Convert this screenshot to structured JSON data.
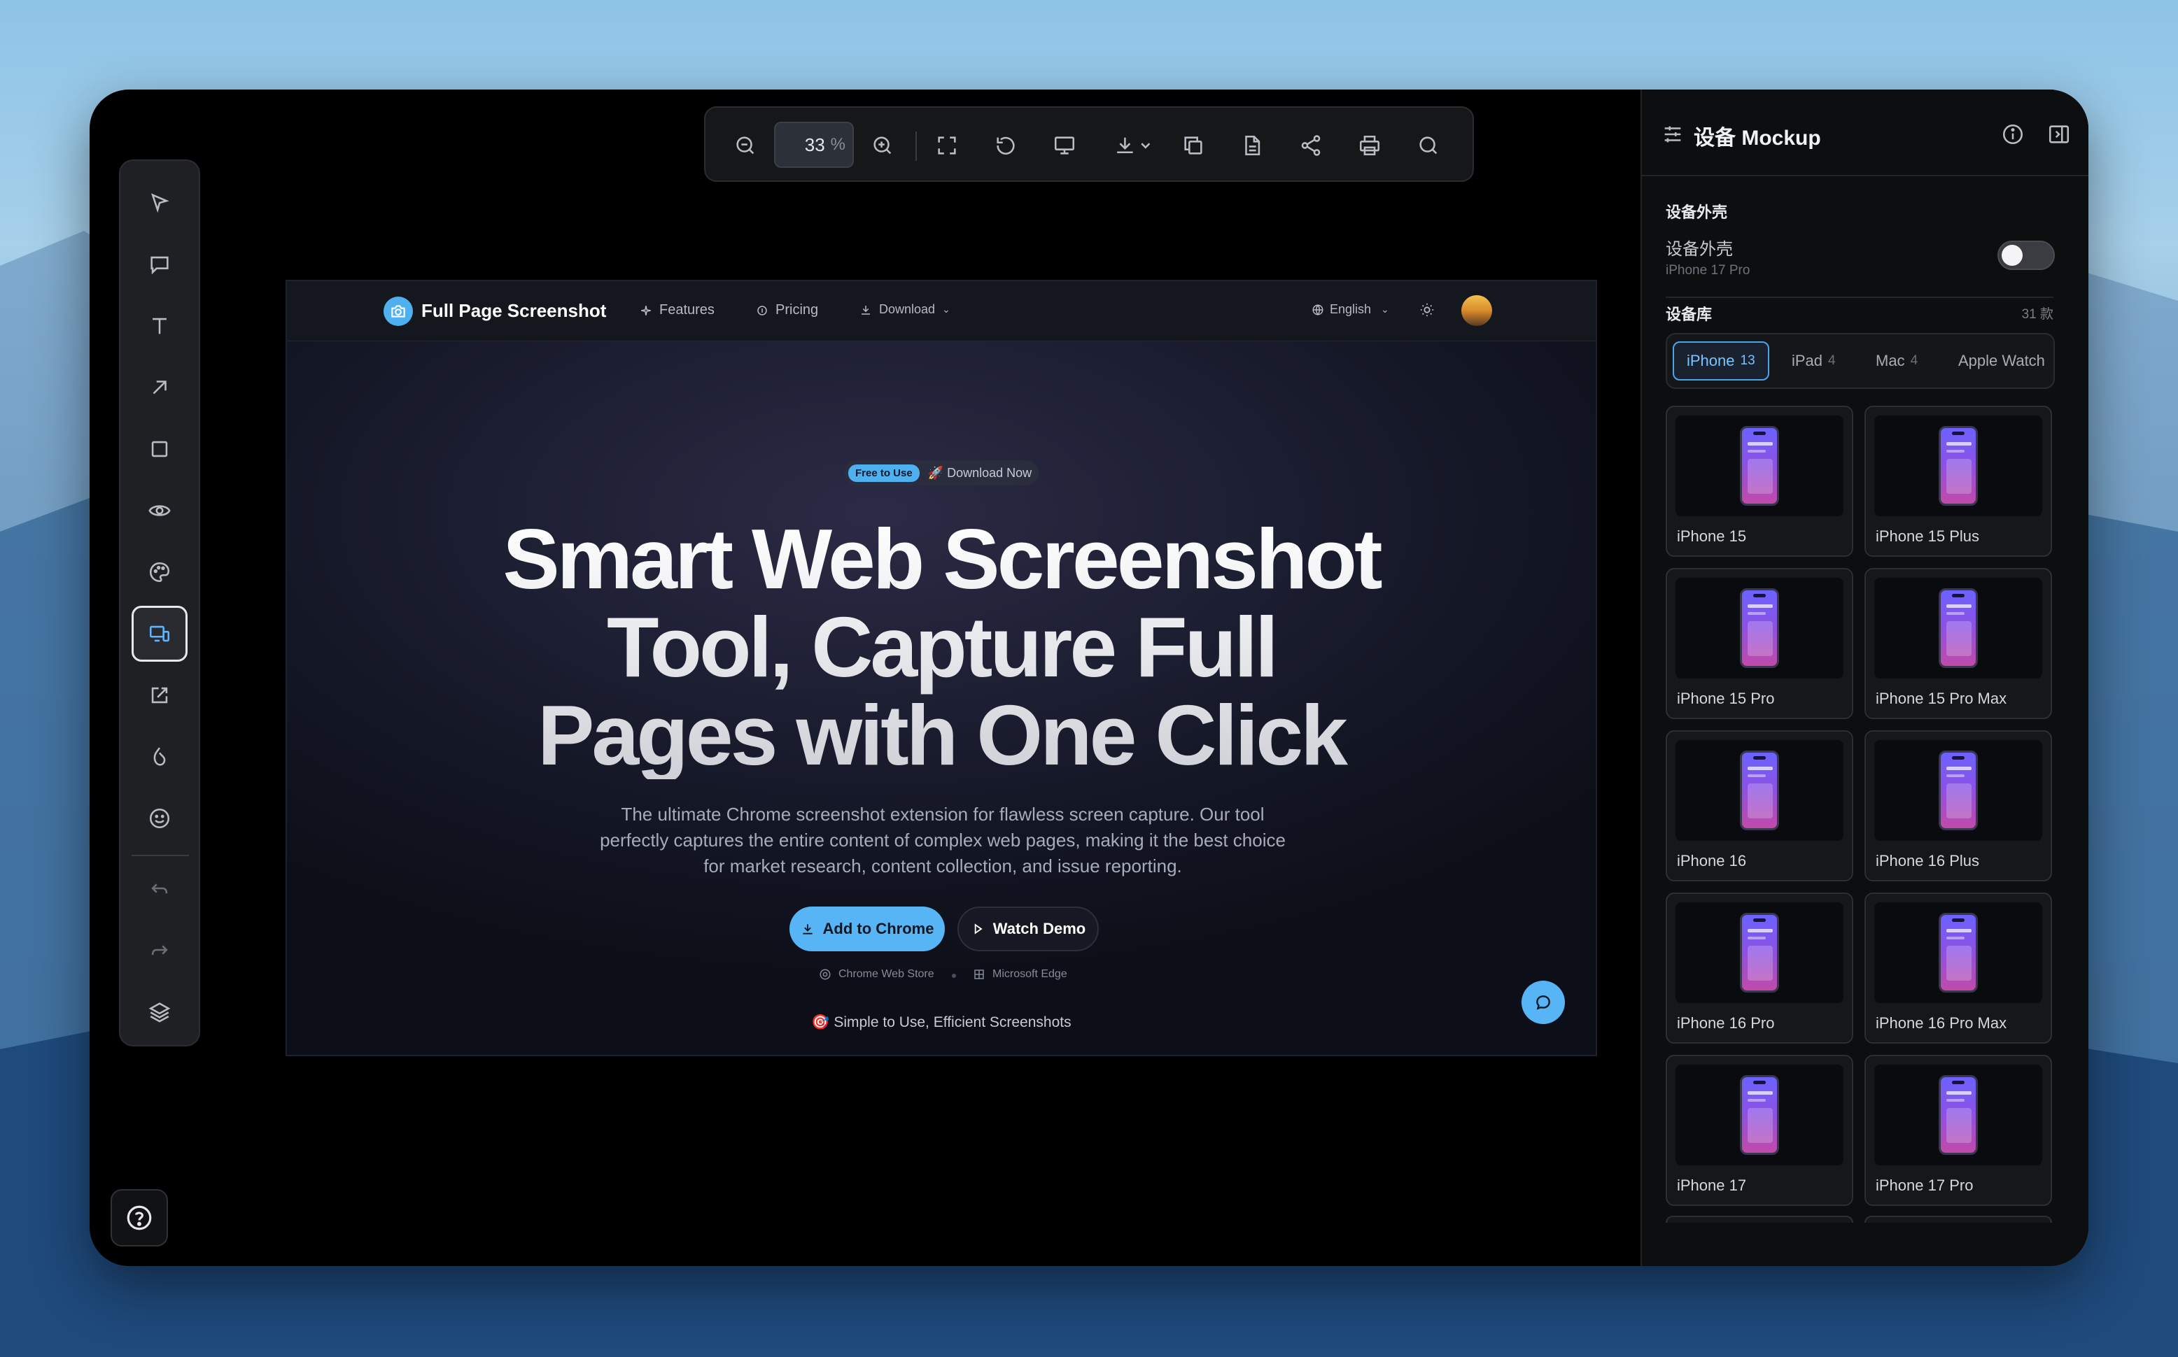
{
  "toolbar": {
    "zoom_value": "33",
    "zoom_unit": "%"
  },
  "preview": {
    "brand": "Full Page Screenshot",
    "nav": [
      "Features",
      "Pricing",
      "Download"
    ],
    "language": "English",
    "badge_chip": "Free to Use",
    "badge_text": "🚀 Download Now",
    "hero_lines": [
      "Smart Web Screenshot",
      "Tool, Capture Full",
      "Pages with One Click"
    ],
    "subtitle": "The ultimate Chrome screenshot extension for flawless screen capture. Our tool perfectly captures the entire content of complex web pages, making it the best choice for market research, content collection, and issue reporting.",
    "primary_btn": "Add to Chrome",
    "ghost_btn": "Watch Demo",
    "stores": [
      "Chrome Web Store",
      "Microsoft Edge"
    ],
    "tagline": "🎯 Simple to Use, Efficient Screenshots",
    "accent": "#57b5f5"
  },
  "panel": {
    "title": "设备 Mockup",
    "case_section": "设备外壳",
    "case_label": "设备外壳",
    "case_device": "iPhone 17 Pro",
    "case_enabled": false,
    "library_section": "设备库",
    "library_count": "31 款",
    "tabs": [
      {
        "label": "iPhone",
        "count": "13"
      },
      {
        "label": "iPad",
        "count": "4"
      },
      {
        "label": "Mac",
        "count": "4"
      },
      {
        "label": "Apple Watch",
        "count": ""
      }
    ],
    "devices": [
      "iPhone 15",
      "iPhone 15 Plus",
      "iPhone 15 Pro",
      "iPhone 15 Pro Max",
      "iPhone 16",
      "iPhone 16 Plus",
      "iPhone 16 Pro",
      "iPhone 16 Pro Max",
      "iPhone 17",
      "iPhone 17 Pro"
    ]
  }
}
